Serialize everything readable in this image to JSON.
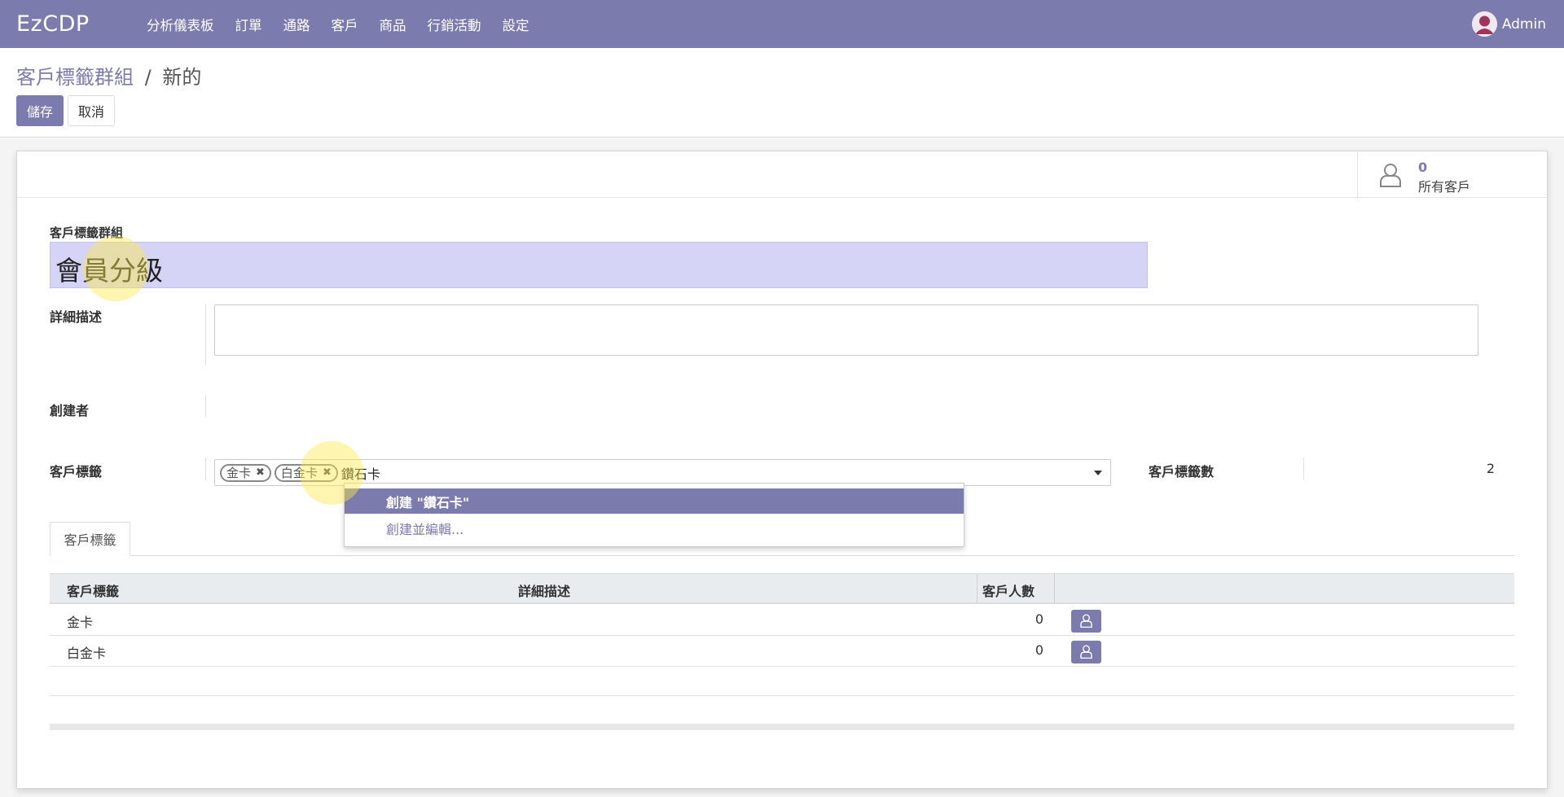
{
  "navbar": {
    "brand": "EzCDP",
    "menu": [
      "分析儀表板",
      "訂單",
      "通路",
      "客戶",
      "商品",
      "行銷活動",
      "設定"
    ],
    "user": "Admin"
  },
  "breadcrumb": {
    "parent": "客戶標籤群組",
    "separator": "/",
    "current": "新的"
  },
  "buttons": {
    "save": "儲存",
    "cancel": "取消"
  },
  "stat_button": {
    "value": "0",
    "label": "所有客戶",
    "icon": "user-outline-icon"
  },
  "form": {
    "group_label": "客戶標籤群組",
    "group_name": "會員分級",
    "description_label": "詳細描述",
    "creator_label": "創建者",
    "tags_label": "客戶標籤",
    "tags": [
      "金卡",
      "白金卡"
    ],
    "typed_text": "鑽石卡",
    "tag_count_label": "客戶標籤數",
    "tag_count": "2"
  },
  "dropdown": {
    "create": "創建 \"鑽石卡\"",
    "create_edit": "創建並編輯..."
  },
  "notebook": {
    "tab": "客戶標籤",
    "columns": [
      "客戶標籤",
      "詳細描述",
      "客戶人數"
    ],
    "rows": [
      {
        "tag": "金卡",
        "description": "",
        "count": "0"
      },
      {
        "tag": "白金卡",
        "description": "",
        "count": "0"
      }
    ]
  },
  "colors": {
    "primary": "#7c7bad",
    "title_bg": "#d5d4f6"
  }
}
